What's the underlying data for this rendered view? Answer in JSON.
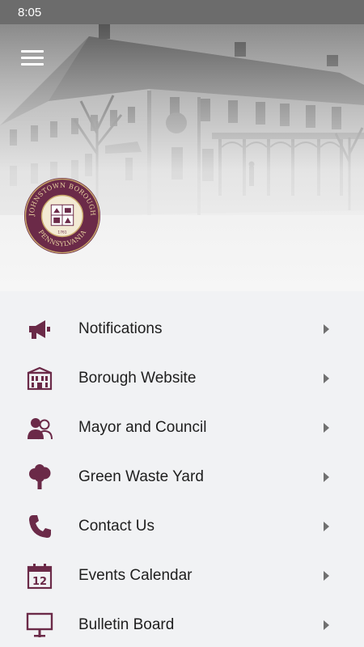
{
  "status_bar": {
    "time": "8:05"
  },
  "header": {
    "menu_icon": "hamburger-menu-icon",
    "seal": {
      "top_text": "JOHNSTOWN BOROUGH",
      "bottom_text": "PENNSYLVANIA",
      "year": "1761"
    }
  },
  "colors": {
    "accent": "#6b2a48",
    "seal_gold": "#c9a86a",
    "chevron": "#707070"
  },
  "menu": {
    "items": [
      {
        "label": "Notifications",
        "icon": "megaphone-icon"
      },
      {
        "label": "Borough Website",
        "icon": "building-icon"
      },
      {
        "label": "Mayor and Council",
        "icon": "people-icon"
      },
      {
        "label": "Green Waste Yard",
        "icon": "tree-icon"
      },
      {
        "label": "Contact Us",
        "icon": "phone-icon"
      },
      {
        "label": "Events Calendar",
        "icon": "calendar-icon"
      },
      {
        "label": "Bulletin Board",
        "icon": "bulletin-board-icon"
      }
    ]
  },
  "calendar_day": "12"
}
